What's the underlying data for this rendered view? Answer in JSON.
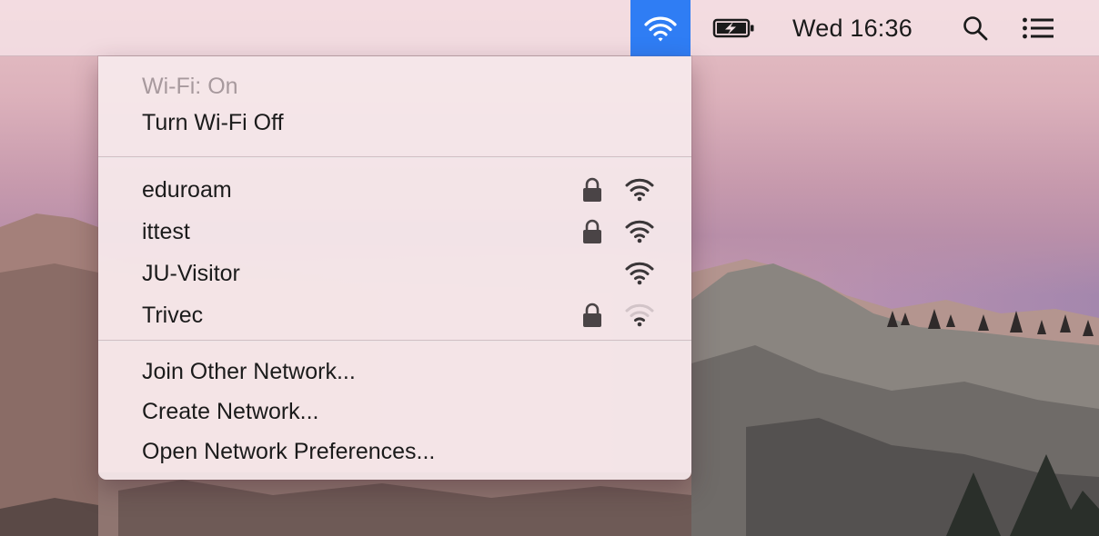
{
  "menubar": {
    "wifi_icon": "wifi-icon",
    "battery_icon": "battery-charging-icon",
    "clock": "Wed 16:36",
    "search_icon": "spotlight-search-icon",
    "notifications_icon": "notification-center-icon",
    "wifi_active_color": "#2f7df4"
  },
  "wifi_menu": {
    "status": "Wi-Fi: On",
    "toggle_label": "Turn Wi-Fi Off",
    "networks": [
      {
        "name": "eduroam",
        "secured": true,
        "signal": "full"
      },
      {
        "name": "ittest",
        "secured": true,
        "signal": "full"
      },
      {
        "name": "JU-Visitor",
        "secured": false,
        "signal": "full"
      },
      {
        "name": "Trivec",
        "secured": true,
        "signal": "weak"
      }
    ],
    "join_other": "Join Other Network...",
    "create_network": "Create Network...",
    "open_preferences": "Open Network Preferences..."
  }
}
